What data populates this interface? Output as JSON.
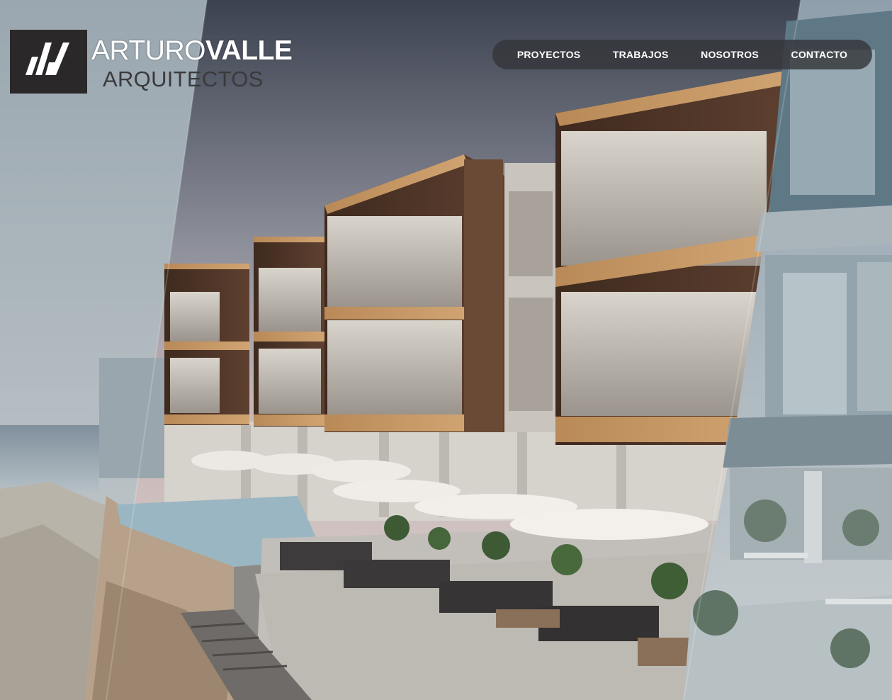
{
  "brand": {
    "name_light": "ARTURO",
    "name_bold": "VALLE",
    "subtitle": "ARQUITECTOS",
    "logo_icon": "av-monogram-icon"
  },
  "nav": {
    "items": [
      {
        "label": "PROYECTOS"
      },
      {
        "label": "TRABAJOS"
      },
      {
        "label": "NOSOTROS"
      },
      {
        "label": "CONTACTO"
      }
    ]
  },
  "hero": {
    "image": "beachfront-apartment-render-photo"
  },
  "colors": {
    "nav_bg": "#34363a",
    "logo_bg": "#2a2828",
    "nav_text": "#ffffff"
  }
}
